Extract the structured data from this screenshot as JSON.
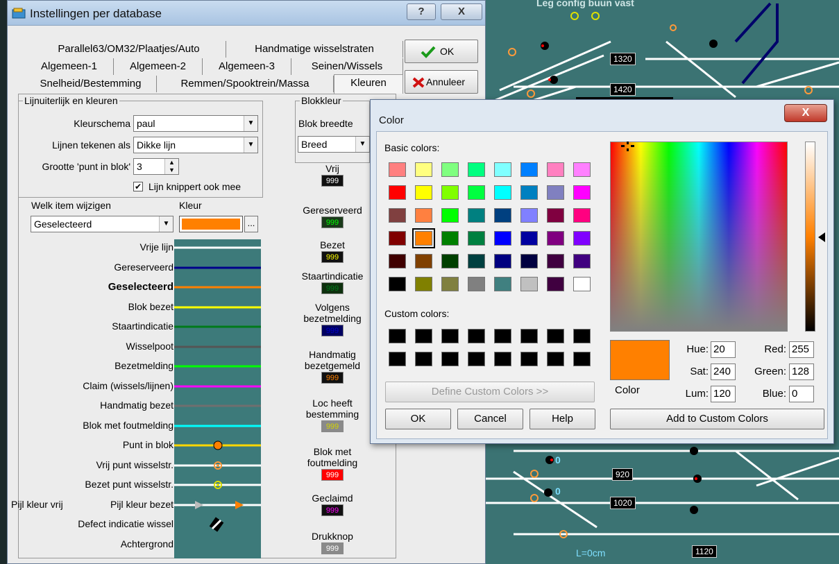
{
  "settings_window": {
    "title": "Instellingen per database",
    "help_button": "?",
    "close_button": "X",
    "tabs_row1": [
      "Parallel63/OM32/Plaatjes/Auto",
      "Handmatige wisselstraten"
    ],
    "tabs_row2": [
      "Algemeen-1",
      "Algemeen-2",
      "Algemeen-3",
      "Seinen/Wissels"
    ],
    "tabs_row3": [
      "Snelheid/Bestemming",
      "Remmen/Spooktrein/Massa",
      "Kleuren"
    ],
    "ok_label": "OK",
    "cancel_label": "Annuleer"
  },
  "lijn_group": {
    "title": "Lijnuiterlijk en kleuren",
    "kleurschema_label": "Kleurschema",
    "kleurschema_value": "paul",
    "lijnen_label": "Lijnen tekenen als",
    "lijnen_value": "Dikke lijn",
    "grootte_label": "Grootte 'punt in blok'",
    "grootte_value": "3",
    "knippert_label": "Lijn knippert ook mee",
    "knippert_checked": true
  },
  "item_select": {
    "welk_label": "Welk item wijzigen",
    "kleur_label": "Kleur",
    "welk_value": "Geselecteerd",
    "kleur_color": "#ff8000",
    "browse_label": "..."
  },
  "line_items": [
    {
      "label": "Vrije lijn",
      "color": "#ffffff",
      "kind": "line"
    },
    {
      "label": "Gereserveerd",
      "color": "#00008b",
      "kind": "line"
    },
    {
      "label": "Geselecteerd",
      "color": "#ff8000",
      "kind": "line",
      "bold": true
    },
    {
      "label": "Blok bezet",
      "color": "#ffff00",
      "kind": "line"
    },
    {
      "label": "Staartindicatie",
      "color": "#007a1a",
      "kind": "line"
    },
    {
      "label": "Wisselpoot",
      "color": "#555555",
      "kind": "line"
    },
    {
      "label": "Bezetmelding",
      "color": "#00ff00",
      "kind": "line"
    },
    {
      "label": "Claim (wissels/lijnen)",
      "color": "#ff00ff",
      "kind": "line"
    },
    {
      "label": "Handmatig bezet",
      "color": "#6f6f6f",
      "kind": "line"
    },
    {
      "label": "Blok met foutmelding",
      "color": "#00ffff",
      "kind": "line"
    },
    {
      "label": "Punt in blok",
      "color": "#ffd700",
      "kind": "dot"
    },
    {
      "label": "Vrij punt wisselstr.",
      "color": "#ff9a3a",
      "kind": "ring"
    },
    {
      "label": "Bezet punt wisselstr.",
      "color": "#e0e000",
      "kind": "ring"
    },
    {
      "label": "Pijl kleur bezet",
      "color": "#ff8000",
      "kind": "arrows",
      "left_label": "Pijl kleur vrij"
    },
    {
      "label": "Defect indicatie wissel",
      "color": "#ffffff",
      "kind": "defect"
    },
    {
      "label": "Achtergrond",
      "color": "#3d7a7a",
      "kind": "none"
    }
  ],
  "blok_group": {
    "title": "Blokkleur",
    "breedte_label": "Blok breedte",
    "breedte_value": "Breed",
    "items": [
      {
        "label": "Vrij",
        "badge": "999",
        "bg": "#111111",
        "fg": "#ffffff"
      },
      {
        "label": "Gereserveerd",
        "badge": "999",
        "bg": "#1a3a1a",
        "fg": "#00ff00"
      },
      {
        "label": "Bezet",
        "badge": "999",
        "bg": "#111111",
        "fg": "#ffff00"
      },
      {
        "label": "Staartindicatie",
        "badge": "999",
        "bg": "#0e300e",
        "fg": "#007a1a"
      },
      {
        "label": "Volgens bezetmelding",
        "badge": "999",
        "bg": "#000060",
        "fg": "#0000cc"
      },
      {
        "label": "Handmatig bezetgemeld",
        "badge": "999",
        "bg": "#111111",
        "fg": "#ff8000"
      },
      {
        "label": "Loc heeft bestemming",
        "badge": "999",
        "bg": "#8a8a8a",
        "fg": "#d4d400"
      },
      {
        "label": "Blok met foutmelding",
        "badge": "999",
        "bg": "#ff0000",
        "fg": "#ffffff"
      },
      {
        "label": "Geclaimd",
        "badge": "999",
        "bg": "#111111",
        "fg": "#ff00ff"
      },
      {
        "label": "Drukknop",
        "badge": "999",
        "bg": "#8a8a8a",
        "fg": "#ffffff"
      }
    ]
  },
  "color_dialog": {
    "title": "Color",
    "close_label": "X",
    "basic_label": "Basic colors:",
    "custom_label": "Custom colors:",
    "basic_colors": [
      "#ff8080",
      "#ffff80",
      "#80ff80",
      "#00ff80",
      "#80ffff",
      "#0080ff",
      "#ff80c0",
      "#ff80ff",
      "#ff0000",
      "#ffff00",
      "#80ff00",
      "#00ff40",
      "#00ffff",
      "#0080c0",
      "#8080c0",
      "#ff00ff",
      "#804040",
      "#ff8040",
      "#00ff00",
      "#008080",
      "#004080",
      "#8080ff",
      "#800040",
      "#ff0080",
      "#800000",
      "#ff8000",
      "#008000",
      "#008040",
      "#0000ff",
      "#0000a0",
      "#800080",
      "#8000ff",
      "#400000",
      "#804000",
      "#004000",
      "#004040",
      "#000080",
      "#000040",
      "#400040",
      "#400080",
      "#000000",
      "#808000",
      "#808040",
      "#808080",
      "#408080",
      "#c0c0c0",
      "#400040",
      "#ffffff"
    ],
    "selected_index": 25,
    "custom_colors": [
      "#000000",
      "#000000",
      "#000000",
      "#000000",
      "#000000",
      "#000000",
      "#000000",
      "#000000",
      "#000000",
      "#000000",
      "#000000",
      "#000000",
      "#000000",
      "#000000",
      "#000000",
      "#000000"
    ],
    "define_custom": "Define Custom Colors >>",
    "ok": "OK",
    "cancel": "Cancel",
    "help": "Help",
    "add_custom": "Add to Custom Colors",
    "color_label": "Color",
    "preview_color": "#ff8000",
    "hue_label": "Hue:",
    "hue": "20",
    "sat_label": "Sat:",
    "sat": "240",
    "lum_label": "Lum:",
    "lum": "120",
    "red_label": "Red:",
    "red": "255",
    "green_label": "Green:",
    "green": "128",
    "blue_label": "Blue:",
    "blue": "0"
  },
  "background_layout": {
    "top_text": "Leg config buun vast",
    "block_labels": [
      "1320",
      "1420",
      "920",
      "1020",
      "1120"
    ],
    "length_label": "L=0cm",
    "partial_zero_labels": [
      "0",
      "0"
    ]
  }
}
